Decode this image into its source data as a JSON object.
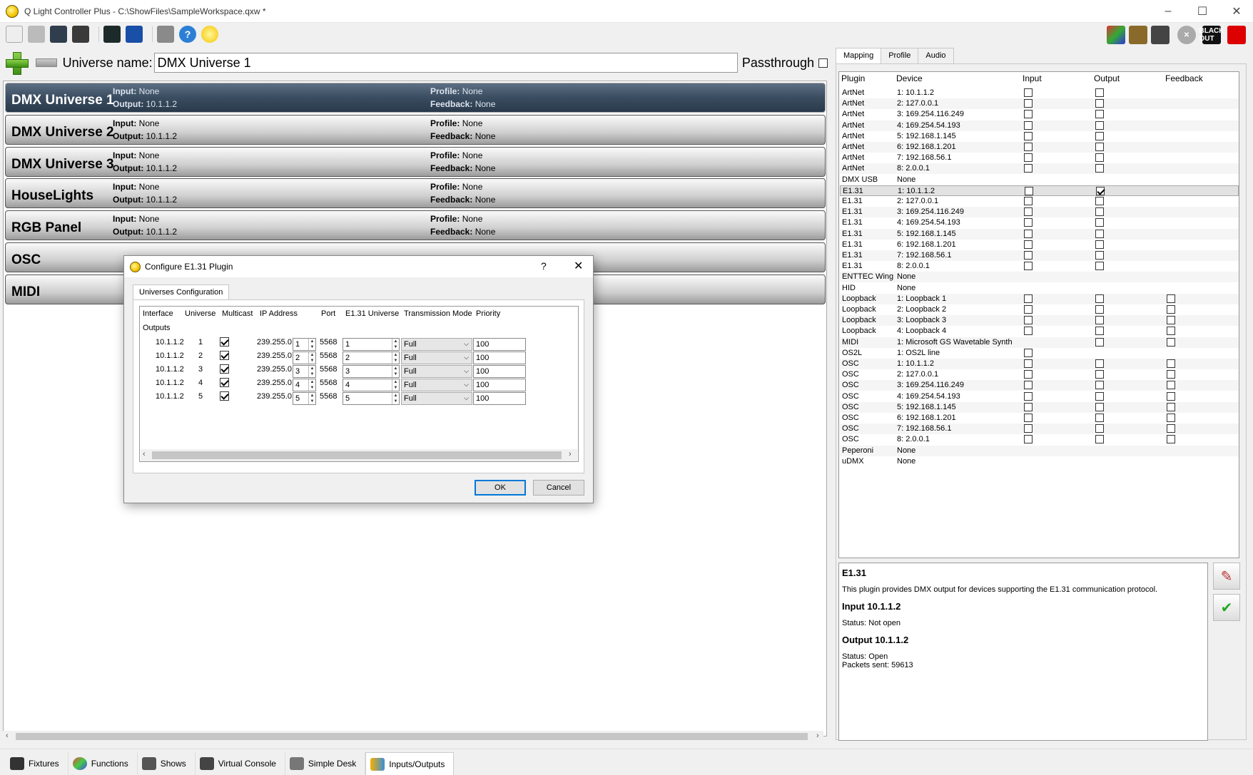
{
  "window": {
    "title": "Q Light Controller Plus - C:\\ShowFiles\\SampleWorkspace.qxw *",
    "minimize": "–",
    "maximize": "☐",
    "close": "✕"
  },
  "toolbar": {
    "icons": [
      "new-icon",
      "print-icon",
      "save-icon",
      "save-as-icon",
      "monitor-icon",
      "address-tool-icon",
      "email-icon",
      "help-icon",
      "about-icon"
    ],
    "blackout_label": "BLACK OUT"
  },
  "universe_bar": {
    "name_label": "Universe name:",
    "name_value": "DMX Universe 1",
    "passthrough_label": "Passthrough"
  },
  "universes": [
    {
      "name": "DMX Universe 1",
      "input_key": "Input:",
      "input": "None",
      "output_key": "Output:",
      "output": "10.1.1.2",
      "profile_key": "Profile:",
      "profile": "None",
      "feedback_key": "Feedback:",
      "feedback": "None",
      "selected": true
    },
    {
      "name": "DMX Universe 2",
      "input_key": "Input:",
      "input": "None",
      "output_key": "Output:",
      "output": "10.1.1.2",
      "profile_key": "Profile:",
      "profile": "None",
      "feedback_key": "Feedback:",
      "feedback": "None"
    },
    {
      "name": "DMX Universe 3",
      "input_key": "Input:",
      "input": "None",
      "output_key": "Output:",
      "output": "10.1.1.2",
      "profile_key": "Profile:",
      "profile": "None",
      "feedback_key": "Feedback:",
      "feedback": "None"
    },
    {
      "name": "HouseLights",
      "input_key": "Input:",
      "input": "None",
      "output_key": "Output:",
      "output": "10.1.1.2",
      "profile_key": "Profile:",
      "profile": "None",
      "feedback_key": "Feedback:",
      "feedback": "None"
    },
    {
      "name": "RGB Panel",
      "input_key": "Input:",
      "input": "None",
      "output_key": "Output:",
      "output": "10.1.1.2",
      "profile_key": "Profile:",
      "profile": "None",
      "feedback_key": "Feedback:",
      "feedback": "None"
    },
    {
      "name": "OSC"
    },
    {
      "name": "MIDI"
    }
  ],
  "right_tabs": [
    "Mapping",
    "Profile",
    "Audio"
  ],
  "mapping": {
    "headers": [
      "Plugin",
      "Device",
      "Input",
      "Output",
      "Feedback"
    ],
    "rows": [
      [
        "ArtNet",
        "1: 10.1.1.2",
        1,
        1,
        0
      ],
      [
        "ArtNet",
        "2: 127.0.0.1",
        1,
        1,
        0
      ],
      [
        "ArtNet",
        "3: 169.254.116.249",
        1,
        1,
        0
      ],
      [
        "ArtNet",
        "4: 169.254.54.193",
        1,
        1,
        0
      ],
      [
        "ArtNet",
        "5: 192.168.1.145",
        1,
        1,
        0
      ],
      [
        "ArtNet",
        "6: 192.168.1.201",
        1,
        1,
        0
      ],
      [
        "ArtNet",
        "7: 192.168.56.1",
        1,
        1,
        0
      ],
      [
        "ArtNet",
        "8: 2.0.0.1",
        1,
        1,
        0
      ],
      [
        "DMX USB",
        "None",
        0,
        0,
        0
      ],
      [
        "E1.31",
        "1: 10.1.1.2",
        1,
        2,
        0
      ],
      [
        "E1.31",
        "2: 127.0.0.1",
        1,
        1,
        0
      ],
      [
        "E1.31",
        "3: 169.254.116.249",
        1,
        1,
        0
      ],
      [
        "E1.31",
        "4: 169.254.54.193",
        1,
        1,
        0
      ],
      [
        "E1.31",
        "5: 192.168.1.145",
        1,
        1,
        0
      ],
      [
        "E1.31",
        "6: 192.168.1.201",
        1,
        1,
        0
      ],
      [
        "E1.31",
        "7: 192.168.56.1",
        1,
        1,
        0
      ],
      [
        "E1.31",
        "8: 2.0.0.1",
        1,
        1,
        0
      ],
      [
        "ENTTEC Wing",
        "None",
        0,
        0,
        0
      ],
      [
        "HID",
        "None",
        0,
        0,
        0
      ],
      [
        "Loopback",
        "1: Loopback 1",
        1,
        1,
        1
      ],
      [
        "Loopback",
        "2: Loopback 2",
        1,
        1,
        1
      ],
      [
        "Loopback",
        "3: Loopback 3",
        1,
        1,
        1
      ],
      [
        "Loopback",
        "4: Loopback 4",
        1,
        1,
        1
      ],
      [
        "MIDI",
        "1: Microsoft GS Wavetable Synth",
        0,
        1,
        1
      ],
      [
        "OS2L",
        "1: OS2L line",
        1,
        0,
        0
      ],
      [
        "OSC",
        "1: 10.1.1.2",
        1,
        1,
        1
      ],
      [
        "OSC",
        "2: 127.0.0.1",
        1,
        1,
        1
      ],
      [
        "OSC",
        "3: 169.254.116.249",
        1,
        1,
        1
      ],
      [
        "OSC",
        "4: 169.254.54.193",
        1,
        1,
        1
      ],
      [
        "OSC",
        "5: 192.168.1.145",
        1,
        1,
        1
      ],
      [
        "OSC",
        "6: 192.168.1.201",
        1,
        1,
        1
      ],
      [
        "OSC",
        "7: 192.168.56.1",
        1,
        1,
        1
      ],
      [
        "OSC",
        "8: 2.0.0.1",
        1,
        1,
        1
      ],
      [
        "Peperoni",
        "None",
        0,
        0,
        0
      ],
      [
        "uDMX",
        "None",
        0,
        0,
        0
      ]
    ]
  },
  "info": {
    "title": "E1.31",
    "desc": "This plugin provides DMX output for devices supporting the E1.31 communication protocol.",
    "input_heading": "Input 10.1.1.2",
    "input_status": "Status: Not open",
    "output_heading": "Output 10.1.1.2",
    "output_status": "Status: Open",
    "packets": "Packets sent: 59613"
  },
  "bottom_tabs": [
    "Fixtures",
    "Functions",
    "Shows",
    "Virtual Console",
    "Simple Desk",
    "Inputs/Outputs"
  ],
  "dialog": {
    "title": "Configure E1.31 Plugin",
    "help": "?",
    "close": "✕",
    "tab": "Universes Configuration",
    "headers": [
      "Interface",
      "Universe",
      "Multicast",
      "IP Address",
      "Port",
      "E1.31 Universe",
      "Transmission Mode",
      "Priority"
    ],
    "section": "Outputs",
    "rows": [
      {
        "iface": "10.1.1.2",
        "universe": "1",
        "ip": "239.255.0.",
        "ip_last": "1",
        "port": "5568",
        "e131": "1",
        "mode": "Full",
        "priority": "100"
      },
      {
        "iface": "10.1.1.2",
        "universe": "2",
        "ip": "239.255.0.",
        "ip_last": "2",
        "port": "5568",
        "e131": "2",
        "mode": "Full",
        "priority": "100"
      },
      {
        "iface": "10.1.1.2",
        "universe": "3",
        "ip": "239.255.0.",
        "ip_last": "3",
        "port": "5568",
        "e131": "3",
        "mode": "Full",
        "priority": "100"
      },
      {
        "iface": "10.1.1.2",
        "universe": "4",
        "ip": "239.255.0.",
        "ip_last": "4",
        "port": "5568",
        "e131": "4",
        "mode": "Full",
        "priority": "100"
      },
      {
        "iface": "10.1.1.2",
        "universe": "5",
        "ip": "239.255.0.",
        "ip_last": "5",
        "port": "5568",
        "e131": "5",
        "mode": "Full",
        "priority": "100"
      }
    ],
    "ok": "OK",
    "cancel": "Cancel"
  }
}
